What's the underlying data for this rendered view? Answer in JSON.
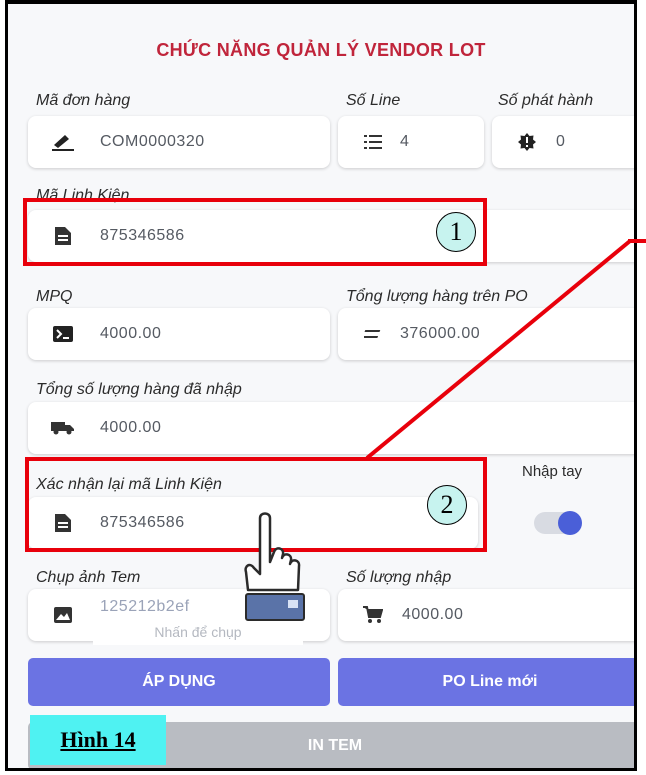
{
  "header": {
    "title": "CHỨC NĂNG QUẢN LÝ VENDOR LOT"
  },
  "fields": {
    "order_code": {
      "label": "Mã đơn hàng",
      "value": "COM0000320",
      "icon": "pen-icon"
    },
    "line_number": {
      "label": "Số Line",
      "value": "4",
      "icon": "list-icon"
    },
    "issue_number": {
      "label": "Số phát hành",
      "value": "0",
      "icon": "badge-icon"
    },
    "component_code": {
      "label": "Mã Linh Kiện",
      "value": "875346586",
      "icon": "document-icon"
    },
    "mpq": {
      "label": "MPQ",
      "value": "4000.00",
      "icon": "terminal-icon"
    },
    "po_total": {
      "label": "Tổng lượng hàng trên PO",
      "value": "376000.00",
      "icon": "equals-icon"
    },
    "imported_total": {
      "label": "Tổng số lượng hàng đã nhập",
      "value": "4000.00",
      "icon": "truck-icon"
    },
    "confirm_component": {
      "label": "Xác nhận lại mã Linh Kiện",
      "value": "875346586",
      "icon": "document-icon"
    },
    "manual_toggle": {
      "label": "Nhập tay",
      "on": true
    },
    "label_photo": {
      "label": "Chụp ảnh Tem",
      "value": "125212b2ef",
      "hint": "Nhấn để chụp",
      "icon": "image-icon"
    },
    "import_qty": {
      "label": "Số lượng nhập",
      "value": "4000.00",
      "icon": "cart-icon"
    }
  },
  "buttons": {
    "apply": "ÁP DỤNG",
    "new_po_line": "PO Line mới",
    "print_label": "IN TEM"
  },
  "annotations": {
    "marker_1": "1",
    "marker_2": "2",
    "figure_caption": "Hình 14"
  },
  "colors": {
    "title": "#c0253b",
    "primary_button": "#6b73e3",
    "disabled_button": "#b9bcc2",
    "highlight_border": "#e8000b",
    "caption_background": "#4ff2f2"
  }
}
